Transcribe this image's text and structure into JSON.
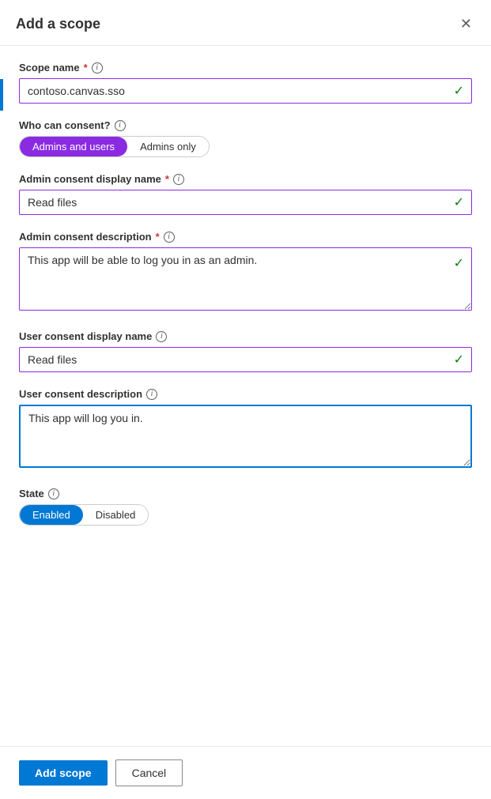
{
  "dialog": {
    "title": "Add a scope",
    "close_label": "✕"
  },
  "fields": {
    "scope_name": {
      "label": "Scope name",
      "required": true,
      "value": "contoso.canvas.sso",
      "placeholder": ""
    },
    "who_can_consent": {
      "label": "Who can consent?",
      "options": [
        {
          "label": "Admins and users",
          "active": true,
          "style": "purple"
        },
        {
          "label": "Admins only",
          "active": false,
          "style": ""
        }
      ]
    },
    "admin_consent_display_name": {
      "label": "Admin consent display name",
      "required": true,
      "value": "Read files",
      "placeholder": ""
    },
    "admin_consent_description": {
      "label": "Admin consent description",
      "required": true,
      "value": "This app will be able to log you in as an admin.",
      "placeholder": ""
    },
    "user_consent_display_name": {
      "label": "User consent display name",
      "required": false,
      "value": "Read files",
      "placeholder": ""
    },
    "user_consent_description": {
      "label": "User consent description",
      "required": false,
      "value": "This app will log you in.",
      "placeholder": ""
    },
    "state": {
      "label": "State",
      "options": [
        {
          "label": "Enabled",
          "active": true,
          "style": "blue"
        },
        {
          "label": "Disabled",
          "active": false,
          "style": ""
        }
      ]
    }
  },
  "footer": {
    "add_scope_label": "Add scope",
    "cancel_label": "Cancel"
  },
  "icons": {
    "info": "i",
    "check": "✓",
    "close": "✕"
  }
}
